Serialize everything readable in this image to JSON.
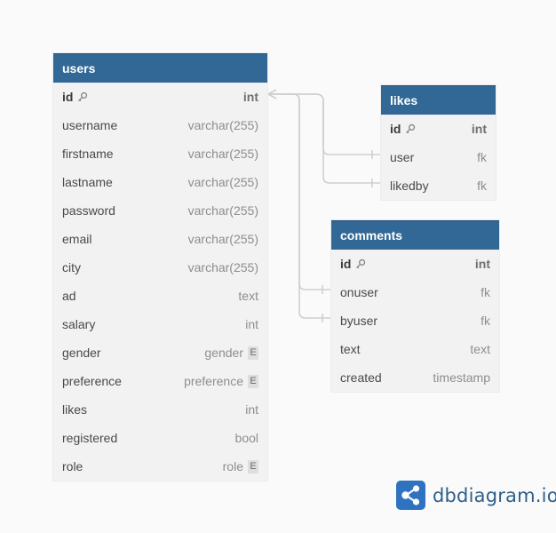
{
  "tables": {
    "users": {
      "name": "users",
      "fields": [
        {
          "name": "id",
          "type": "int",
          "pk": true
        },
        {
          "name": "username",
          "type": "varchar(255)"
        },
        {
          "name": "firstname",
          "type": "varchar(255)"
        },
        {
          "name": "lastname",
          "type": "varchar(255)"
        },
        {
          "name": "password",
          "type": "varchar(255)"
        },
        {
          "name": "email",
          "type": "varchar(255)"
        },
        {
          "name": "city",
          "type": "varchar(255)"
        },
        {
          "name": "ad",
          "type": "text"
        },
        {
          "name": "salary",
          "type": "int"
        },
        {
          "name": "gender",
          "type": "gender",
          "enum_badge": "E"
        },
        {
          "name": "preference",
          "type": "preference",
          "enum_badge": "E"
        },
        {
          "name": "likes",
          "type": "int"
        },
        {
          "name": "registered",
          "type": "bool"
        },
        {
          "name": "role",
          "type": "role",
          "enum_badge": "E"
        }
      ]
    },
    "likes": {
      "name": "likes",
      "fields": [
        {
          "name": "id",
          "type": "int",
          "pk": true
        },
        {
          "name": "user",
          "type": "fk"
        },
        {
          "name": "likedby",
          "type": "fk"
        }
      ]
    },
    "comments": {
      "name": "comments",
      "fields": [
        {
          "name": "id",
          "type": "int",
          "pk": true
        },
        {
          "name": "onuser",
          "type": "fk"
        },
        {
          "name": "byuser",
          "type": "fk"
        },
        {
          "name": "text",
          "type": "text"
        },
        {
          "name": "created",
          "type": "timestamp"
        }
      ]
    }
  },
  "relations": [
    {
      "from": "users.id",
      "to": "likes.user"
    },
    {
      "from": "users.id",
      "to": "likes.likedby"
    },
    {
      "from": "users.id",
      "to": "comments.onuser"
    },
    {
      "from": "users.id",
      "to": "comments.byuser"
    }
  ],
  "brand": {
    "text": "dbdiagram.io",
    "icon": "dbdiagram-logo-icon"
  },
  "colors": {
    "header": "#316896",
    "body": "#f2f2f2",
    "line": "#cfcfcf",
    "brand": "#2f5f8a"
  }
}
